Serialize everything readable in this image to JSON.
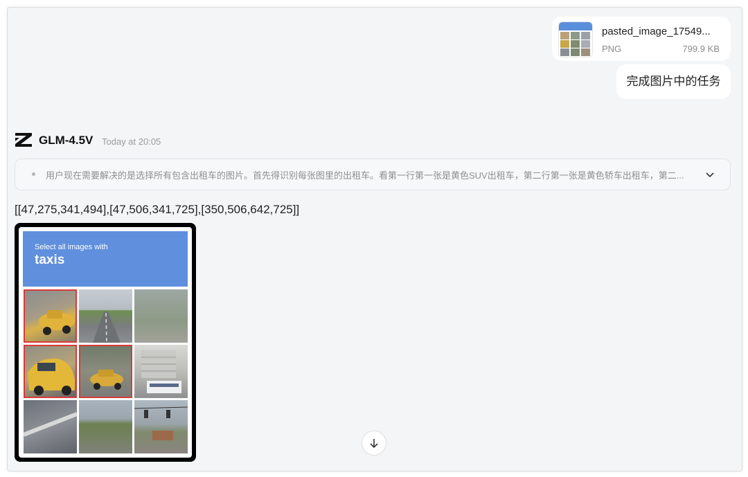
{
  "attachment": {
    "name": "pasted_image_17549...",
    "type": "PNG",
    "size": "799.9 KB",
    "icon": "image-thumbnail"
  },
  "user_message": "完成图片中的任务",
  "model": {
    "name": "GLM-4.5V",
    "timestamp": "Today at 20:05",
    "logo_icon": "z-logo"
  },
  "thinking": {
    "summary": "用户现在需要解决的是选择所有包含出租车的图片。首先得识别每张图里的出租车。看第一行第一张是黄色SUV出租车，第二行第一张是黄色轿车出租车，第二...",
    "toggle_icon": "chevron-down-icon"
  },
  "answer": "[[47,275,341,494],[47,506,341,725],[350,506,642,725]]",
  "captcha": {
    "prompt_small": "Select all images with",
    "prompt_big": "taxis",
    "selected_tiles": [
      true,
      false,
      false,
      true,
      true,
      false,
      false,
      false,
      false
    ]
  },
  "colors": {
    "background": "#f4f5f7",
    "bubble": "#ffffff",
    "captcha_banner": "#5f8fdd",
    "selection": "#d93a3a"
  }
}
